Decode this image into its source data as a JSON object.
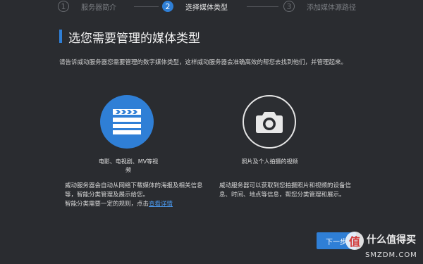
{
  "steps": [
    {
      "number": "1",
      "label": "服务器简介"
    },
    {
      "number": "2",
      "label": "选择媒体类型"
    },
    {
      "number": "3",
      "label": "添加媒体源路径"
    }
  ],
  "header": {
    "title": "选您需要管理的媒体类型",
    "subtitle": "请告诉威动服务器您需要管理的数字媒体类型，这样威动服务器会准确高效的帮您去找到他们，并管理起来。"
  },
  "media_types": {
    "video": {
      "icon": "clapperboard-icon",
      "label": "电影、电视剧、MV等视频",
      "desc_line1": "威动服务器会自动从网络下载媒体的海报及相关信息等，智能分类管理及展示给您。",
      "desc_line2": "智能分类需要一定的规则，点击",
      "desc_link": "查看详情"
    },
    "photo": {
      "icon": "camera-icon",
      "label": "照片及个人拍摄的视频",
      "desc": "威动服务器可以获取到您拍摄照片和视频的设备信息、时间、地点等信息，帮您分类管理和展示。"
    }
  },
  "footer": {
    "next_label": "下一步"
  },
  "watermark": {
    "badge": "值",
    "text": "什么值得买",
    "site": "SMZDM.COM"
  },
  "colors": {
    "background": "#2a2c30",
    "accent": "#2f7fd6",
    "link": "#4a98ec"
  }
}
